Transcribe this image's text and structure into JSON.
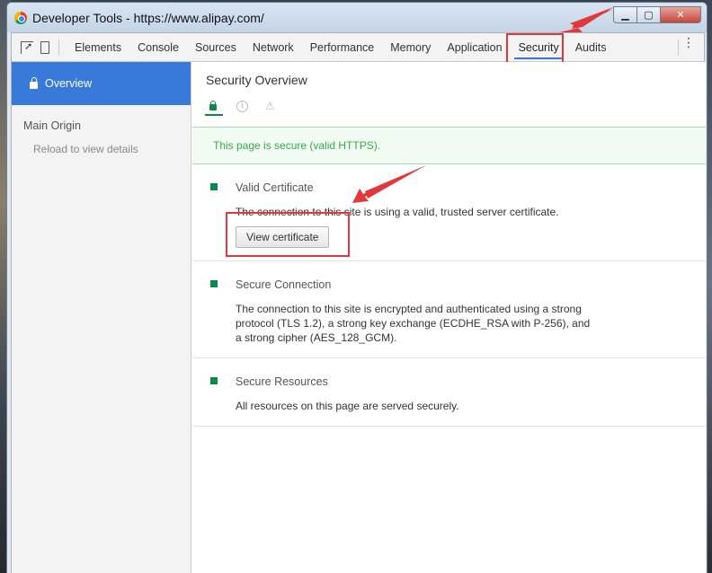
{
  "window": {
    "title": "Developer Tools - https://www.alipay.com/",
    "controls": {
      "minimize": "▁",
      "maximize": "▢",
      "close": "✕"
    }
  },
  "toolbar": {
    "tabs": [
      {
        "label": "Elements"
      },
      {
        "label": "Console"
      },
      {
        "label": "Sources"
      },
      {
        "label": "Network"
      },
      {
        "label": "Performance"
      },
      {
        "label": "Memory"
      },
      {
        "label": "Application"
      },
      {
        "label": "Security",
        "active": true
      },
      {
        "label": "Audits"
      }
    ],
    "more_icon": "⋮"
  },
  "sidebar": {
    "overview_label": "Overview",
    "main_origin_label": "Main Origin",
    "reload_hint": "Reload to view details"
  },
  "main": {
    "title": "Security Overview",
    "banner": "This page is secure (valid HTTPS).",
    "sections": [
      {
        "title": "Valid Certificate",
        "description": "The connection to this site is using a valid, trusted server certificate.",
        "button_label": "View certificate"
      },
      {
        "title": "Secure Connection",
        "description": "The connection to this site is encrypted and authenticated using a strong protocol (TLS 1.2), a strong key exchange (ECDHE_RSA with P-256), and a strong cipher (AES_128_GCM)."
      },
      {
        "title": "Secure Resources",
        "description": "All resources on this page are served securely."
      }
    ]
  },
  "colors": {
    "accent_blue": "#3879d9",
    "secure_green": "#0a8a44",
    "banner_text_green": "#37a84b",
    "annotation_red": "#e0383b"
  }
}
